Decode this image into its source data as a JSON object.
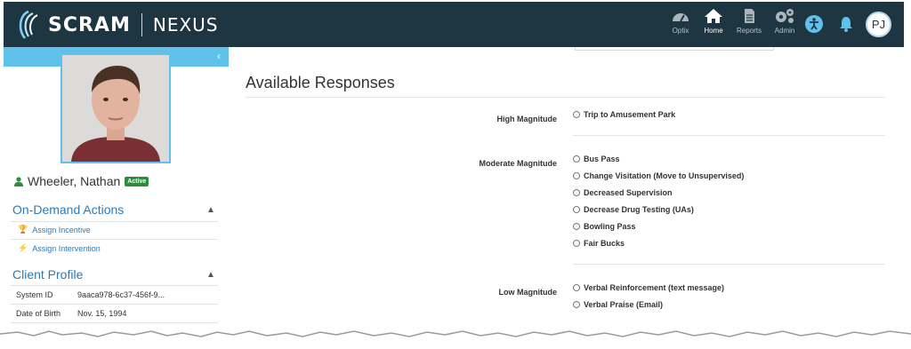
{
  "app": {
    "brand": "SCRAM",
    "product": "NEXUS"
  },
  "nav": [
    {
      "label": "Optix",
      "icon": "gauge-icon"
    },
    {
      "label": "Home",
      "icon": "home-icon"
    },
    {
      "label": "Reports",
      "icon": "report-icon"
    },
    {
      "label": "Admin",
      "icon": "gears-icon"
    }
  ],
  "header_icons": [
    "accessibility-icon",
    "bell-icon"
  ],
  "user": {
    "initials": "PJ"
  },
  "client": {
    "name": "Wheeler, Nathan",
    "status": "Active"
  },
  "on_demand": {
    "title": "On-Demand Actions",
    "actions": [
      {
        "label": "Assign Incentive",
        "icon": "trophy-icon"
      },
      {
        "label": "Assign Intervention",
        "icon": "bolt-icon"
      }
    ]
  },
  "profile": {
    "title": "Client Profile",
    "rows": [
      {
        "label": "System ID",
        "value": "9aaca978-6c37-456f-9..."
      },
      {
        "label": "Date of Birth",
        "value": "Nov. 15, 1994"
      }
    ]
  },
  "main": {
    "title": "Available Responses",
    "groups": [
      {
        "label": "High Magnitude",
        "options": [
          "Trip to Amusement Park"
        ]
      },
      {
        "label": "Moderate Magnitude",
        "options": [
          "Bus Pass",
          "Change Visitation (Move to Unsupervised)",
          "Decreased Supervision",
          "Decrease Drug Testing (UAs)",
          "Bowling Pass",
          "Fair Bucks"
        ]
      },
      {
        "label": "Low Magnitude",
        "options": [
          "Verbal Reinforcement (text message)",
          "Verbal Praise (Email)"
        ]
      }
    ]
  },
  "colors": {
    "header_bg": "#1e3641",
    "accent_blue": "#5fc1ea",
    "link_blue": "#2c7ab8",
    "badge_green": "#2e8b3a"
  }
}
